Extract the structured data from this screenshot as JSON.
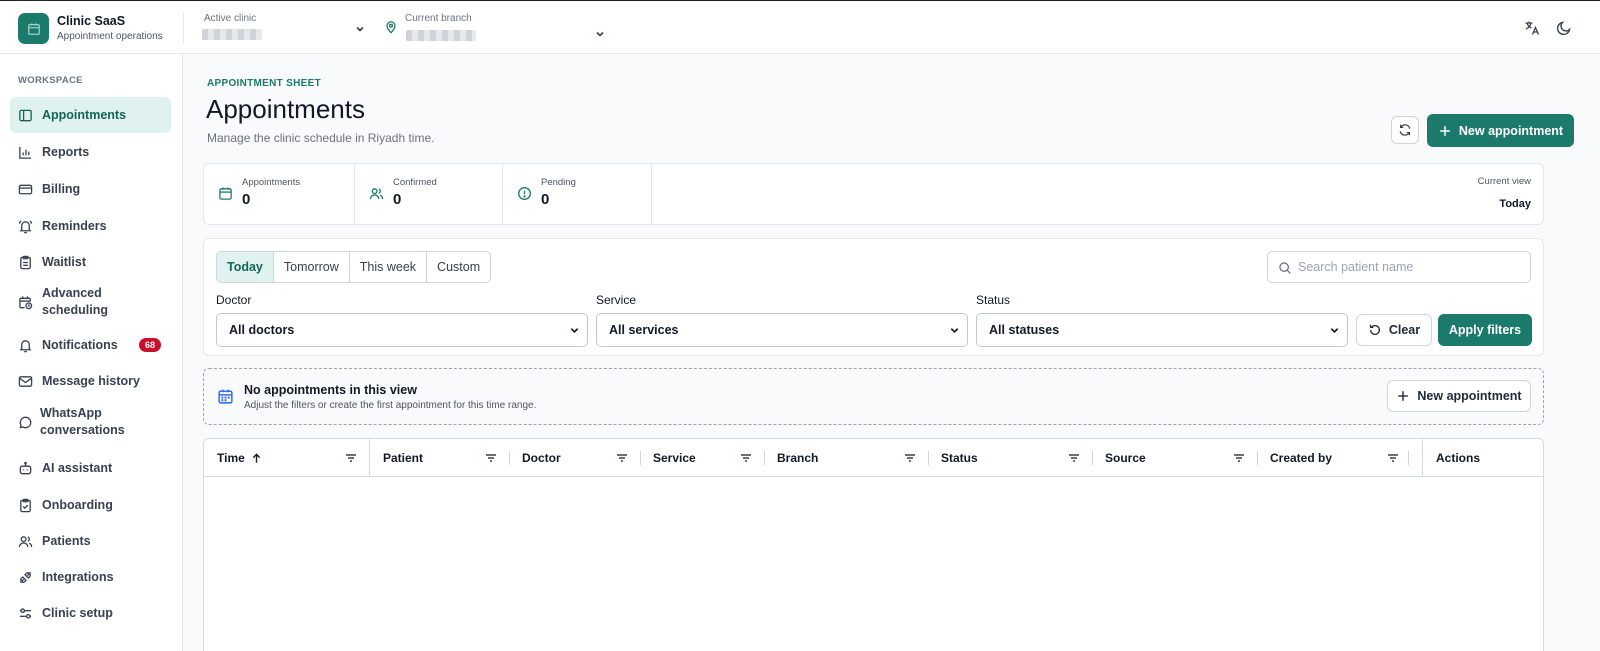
{
  "header": {
    "brand_title": "Clinic SaaS",
    "brand_subtitle": "Appointment operations",
    "active_clinic_label": "Active clinic",
    "current_branch_label": "Current branch",
    "icons": [
      "translate-icon",
      "moon-icon"
    ]
  },
  "sidebar": {
    "section_label": "WORKSPACE",
    "items": [
      {
        "label": "Appointments",
        "icon": "sidebar-panel-icon",
        "active": true
      },
      {
        "label": "Reports",
        "icon": "bar-chart-icon"
      },
      {
        "label": "Billing",
        "icon": "credit-card-icon"
      },
      {
        "label": "Reminders",
        "icon": "bell-ring-icon"
      },
      {
        "label": "Waitlist",
        "icon": "clipboard-icon"
      },
      {
        "label": "Advanced scheduling",
        "icon": "calendar-clock-icon"
      },
      {
        "label": "Notifications",
        "icon": "bell-icon",
        "badge": "68"
      },
      {
        "label": "Message history",
        "icon": "mail-icon"
      },
      {
        "label": "WhatsApp conversations",
        "icon": "chat-bubble-icon"
      },
      {
        "label": "AI assistant",
        "icon": "bot-icon"
      },
      {
        "label": "Onboarding",
        "icon": "clipboard-check-icon"
      },
      {
        "label": "Patients",
        "icon": "users-icon"
      },
      {
        "label": "Integrations",
        "icon": "plug-icon"
      },
      {
        "label": "Clinic setup",
        "icon": "sliders-icon"
      }
    ]
  },
  "page": {
    "eyebrow": "APPOINTMENT SHEET",
    "title": "Appointments",
    "subtitle": "Manage the clinic schedule in Riyadh time.",
    "new_appointment_label": "New appointment"
  },
  "stats": {
    "appointments_label": "Appointments",
    "appointments_value": "0",
    "confirmed_label": "Confirmed",
    "confirmed_value": "0",
    "pending_label": "Pending",
    "pending_value": "0",
    "current_view_label": "Current view",
    "current_view_value": "Today"
  },
  "filters": {
    "ranges": [
      "Today",
      "Tomorrow",
      "This week",
      "Custom"
    ],
    "active_range": "Today",
    "search_placeholder": "Search patient name",
    "doctor_label": "Doctor",
    "doctor_value": "All doctors",
    "service_label": "Service",
    "service_value": "All services",
    "status_label": "Status",
    "status_value": "All statuses",
    "clear_label": "Clear",
    "apply_label": "Apply filters"
  },
  "empty_state": {
    "title": "No appointments in this view",
    "subtitle": "Adjust the filters or create the first appointment for this time range.",
    "button_label": "New appointment"
  },
  "table": {
    "columns": [
      "Time",
      "Patient",
      "Doctor",
      "Service",
      "Branch",
      "Status",
      "Source",
      "Created by",
      "Actions"
    ]
  },
  "colors": {
    "accent": "#1b7a6b",
    "accent_light": "#e0f2ef",
    "badge": "#c8102e"
  }
}
